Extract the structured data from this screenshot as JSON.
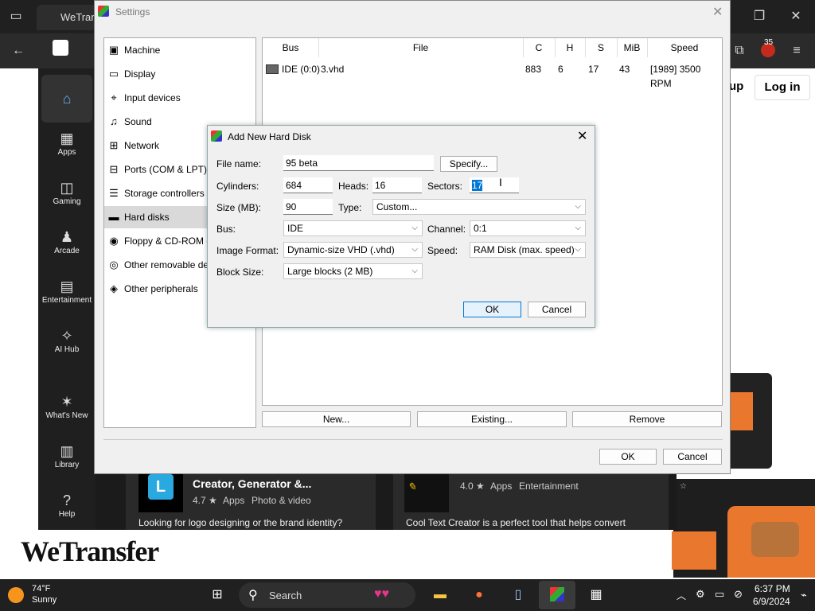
{
  "browser": {
    "tab_title": "WeTran"
  },
  "store": {
    "sidebar": [
      {
        "label": "",
        "icon": "home-icon"
      },
      {
        "label": "Apps",
        "icon": "apps-icon"
      },
      {
        "label": "Gaming",
        "icon": "gamepad-icon"
      },
      {
        "label": "Arcade",
        "icon": "joystick-icon"
      },
      {
        "label": "Entertainment",
        "icon": "clapper-icon"
      },
      {
        "label": "AI Hub",
        "icon": "sparkle-icon"
      },
      {
        "label": "What's New",
        "icon": "party-icon"
      },
      {
        "label": "Library",
        "icon": "library-icon"
      },
      {
        "label": "Help",
        "icon": "help-icon"
      }
    ],
    "header_buttons": {
      "signup": "up",
      "login": "Log in"
    },
    "cards": [
      {
        "title": "Creator, Generator &...",
        "rating": "4.7 ★",
        "category": "Apps",
        "subcategory": "Photo & video",
        "description": "Looking for logo designing or the brand identity?"
      },
      {
        "title": "",
        "rating": "4.0 ★",
        "category": "Apps",
        "subcategory": "Entertainment",
        "description": "Cool Text Creator is a perfect tool that helps convert"
      }
    ],
    "badge_count": "35",
    "watermark": "WeTransfer"
  },
  "settings": {
    "title": "Settings",
    "tree": [
      {
        "label": "Machine",
        "icon": "chip-icon"
      },
      {
        "label": "Display",
        "icon": "monitor-icon"
      },
      {
        "label": "Input devices",
        "icon": "mouse-icon"
      },
      {
        "label": "Sound",
        "icon": "sound-icon"
      },
      {
        "label": "Network",
        "icon": "network-icon"
      },
      {
        "label": "Ports (COM & LPT)",
        "icon": "port-icon"
      },
      {
        "label": "Storage controllers",
        "icon": "storage-icon"
      },
      {
        "label": "Hard disks",
        "icon": "harddisk-icon"
      },
      {
        "label": "Floppy & CD-ROM d",
        "icon": "floppy-icon"
      },
      {
        "label": "Other removable de",
        "icon": "removable-icon"
      },
      {
        "label": "Other peripherals",
        "icon": "peripherals-icon"
      }
    ],
    "columns": [
      "Bus",
      "File",
      "C",
      "H",
      "S",
      "MiB",
      "Speed"
    ],
    "rows": [
      {
        "bus": "IDE (0:0)",
        "file": "3.vhd",
        "c": "883",
        "h": "6",
        "s": "17",
        "mib": "43",
        "speed": "[1989] 3500 RPM"
      }
    ],
    "buttons": {
      "new": "New...",
      "existing": "Existing...",
      "remove": "Remove",
      "ok": "OK",
      "cancel": "Cancel"
    }
  },
  "dialog": {
    "title": "Add New Hard Disk",
    "file_name_label": "File name:",
    "file_name": "95 beta",
    "specify": "Specify...",
    "cylinders_label": "Cylinders:",
    "cylinders": "684",
    "heads_label": "Heads:",
    "heads": "16",
    "sectors_label": "Sectors:",
    "sectors": "17",
    "size_label": "Size (MB):",
    "size": "90",
    "type_label": "Type:",
    "type": "Custom...",
    "bus_label": "Bus:",
    "bus": "IDE",
    "channel_label": "Channel:",
    "channel": "0:1",
    "format_label": "Image Format:",
    "format": "Dynamic-size VHD (.vhd)",
    "speed_label": "Speed:",
    "speed": "RAM Disk (max. speed)",
    "block_label": "Block Size:",
    "block": "Large blocks (2 MB)",
    "ok": "OK",
    "cancel": "Cancel"
  },
  "taskbar": {
    "weather_temp": "74°F",
    "weather_desc": "Sunny",
    "search": "Search",
    "time": "6:37 PM",
    "date": "6/9/2024"
  }
}
